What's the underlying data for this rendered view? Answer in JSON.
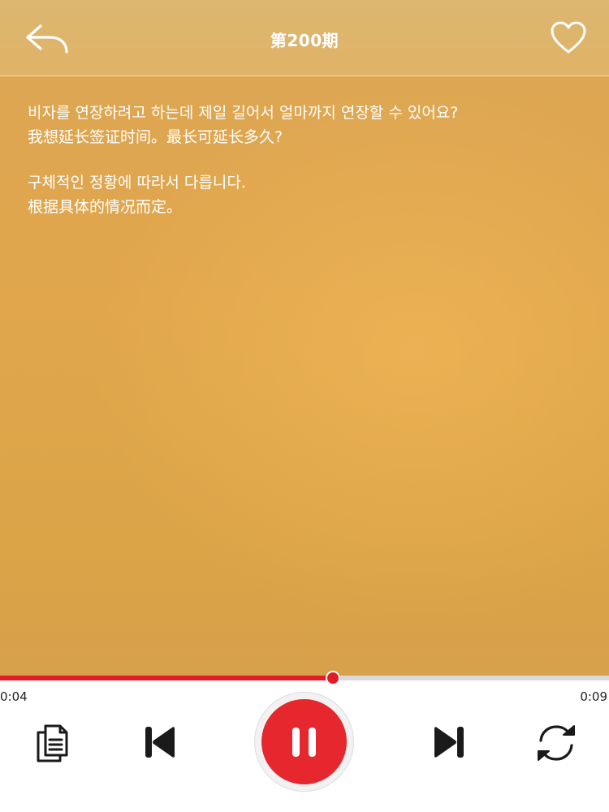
{
  "header": {
    "title": "第200期",
    "back_icon": "back-arrow-icon",
    "favorite_icon": "heart-outline-icon"
  },
  "content": {
    "question_ko": "비자를 연장하려고 하는데 제일 길어서 얼마까지 연장할 수 있어요?",
    "question_zh": "我想延长签证时间。最长可延长多久?",
    "answer_ko": "구체적인 정황에 따라서 다릅니다.",
    "answer_zh": "根据具体的情况而定。"
  },
  "player": {
    "current_time": "0:04",
    "duration": "0:09",
    "progress": 0.545,
    "state": "playing",
    "controls": {
      "playlist_icon": "documents-icon",
      "prev_icon": "skip-previous-icon",
      "play_pause_icon": "pause-icon",
      "next_icon": "skip-next-icon",
      "repeat_icon": "repeat-icon"
    }
  },
  "colors": {
    "accent": "#e6272e",
    "background": "#e1a64c",
    "text_on_bg": "#ffffff"
  }
}
